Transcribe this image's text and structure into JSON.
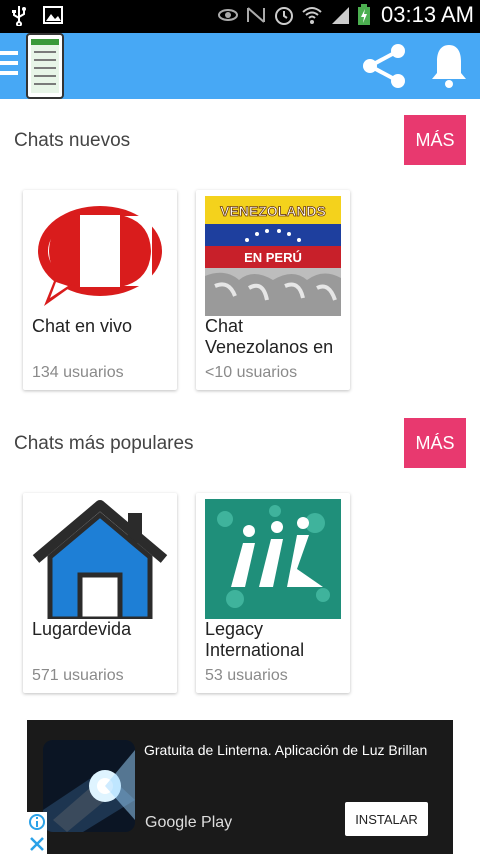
{
  "status_bar": {
    "time": "03:13 AM",
    "icons": [
      "usb-icon",
      "image-icon",
      "eye-icon",
      "nfc-icon",
      "alarm-icon",
      "wifi-icon",
      "signal-icon",
      "battery-charging-icon"
    ]
  },
  "app_bar": {
    "menu_icon": "menu-icon",
    "logo": "app-logo",
    "actions": [
      "share-icon",
      "bell-icon"
    ],
    "color": "#47a8f5"
  },
  "sections": [
    {
      "title": "Chats nuevos",
      "more_label": "MÁS",
      "cards": [
        {
          "name": "Chat en vivo",
          "users": "134 usuarios"
        },
        {
          "name": "Chat Venezolanos en",
          "users": "<10 usuarios",
          "thumb_text_top": "VENEZOLANDS",
          "thumb_text_mid": "EN PERÚ"
        }
      ]
    },
    {
      "title": "Chats más populares",
      "more_label": "MÁS",
      "cards": [
        {
          "name": "Lugardevida",
          "users": "571 usuarios"
        },
        {
          "name": "Legacy International",
          "users": "53 usuarios"
        }
      ]
    }
  ],
  "ad": {
    "text": "Gratuita de Linterna. Aplicación de Luz Brillan",
    "store": "Google Play",
    "install_label": "INSTALAR"
  },
  "colors": {
    "accent": "#e8396f",
    "appbar": "#47a8f5"
  }
}
